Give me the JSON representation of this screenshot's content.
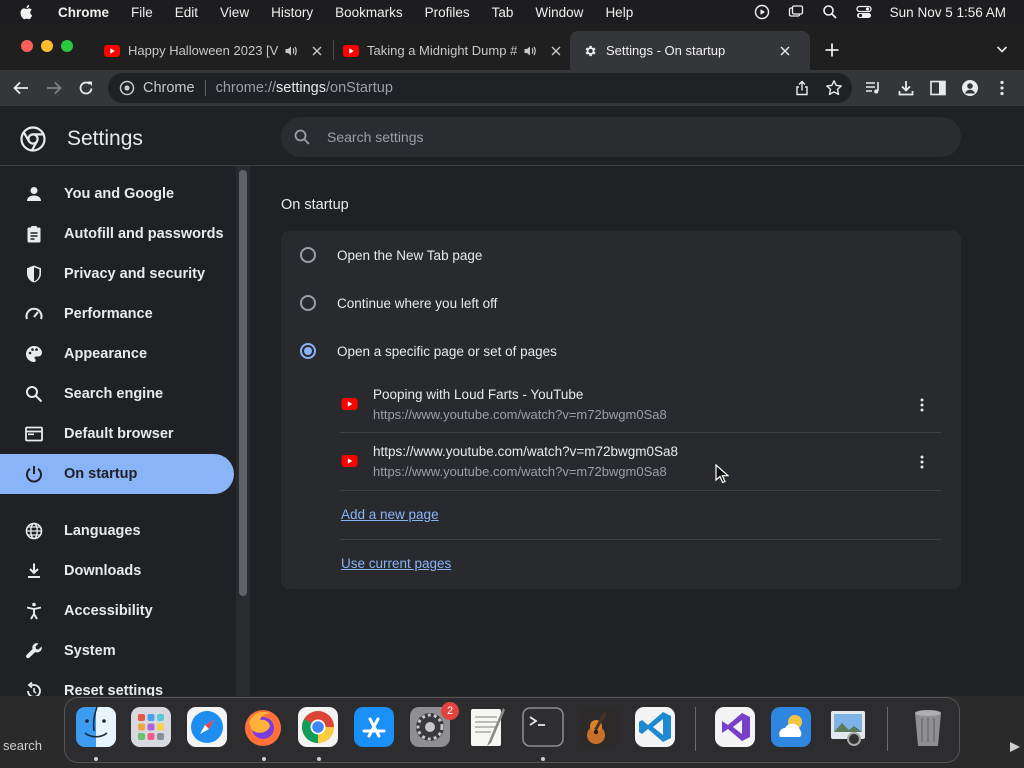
{
  "menubar": {
    "app": "Chrome",
    "items": [
      "File",
      "Edit",
      "View",
      "History",
      "Bookmarks",
      "Profiles",
      "Tab",
      "Window",
      "Help"
    ],
    "datetime": "Sun Nov 5  1:56 AM"
  },
  "tabs": [
    {
      "title": "Happy Halloween 2023 [V",
      "favicon": "youtube-icon",
      "audio": true
    },
    {
      "title": "Taking a Midnight Dump #",
      "favicon": "youtube-icon",
      "audio": true
    },
    {
      "title": "Settings - On startup",
      "favicon": "gear-icon",
      "active": true
    }
  ],
  "omnibox": {
    "host": "Chrome",
    "scheme": "chrome://",
    "path_main": "settings",
    "path_rest": "/onStartup"
  },
  "settings": {
    "title": "Settings",
    "search_placeholder": "Search settings"
  },
  "sidebar": {
    "items": [
      {
        "label": "You and Google",
        "icon": "person-icon"
      },
      {
        "label": "Autofill and passwords",
        "icon": "clipboard-icon"
      },
      {
        "label": "Privacy and security",
        "icon": "shield-icon"
      },
      {
        "label": "Performance",
        "icon": "speedometer-icon"
      },
      {
        "label": "Appearance",
        "icon": "palette-icon"
      },
      {
        "label": "Search engine",
        "icon": "search-icon"
      },
      {
        "label": "Default browser",
        "icon": "browser-icon"
      },
      {
        "label": "On startup",
        "icon": "power-icon",
        "selected": true
      },
      {
        "label": "Languages",
        "icon": "globe-icon"
      },
      {
        "label": "Downloads",
        "icon": "download-icon"
      },
      {
        "label": "Accessibility",
        "icon": "accessibility-icon"
      },
      {
        "label": "System",
        "icon": "wrench-icon"
      },
      {
        "label": "Reset settings",
        "icon": "reset-icon"
      }
    ]
  },
  "startup": {
    "section_title": "On startup",
    "options": [
      {
        "label": "Open the New Tab page",
        "selected": false
      },
      {
        "label": "Continue where you left off",
        "selected": false
      },
      {
        "label": "Open a specific page or set of pages",
        "selected": true
      }
    ],
    "pages": [
      {
        "title": "Pooping with Loud Farts - YouTube",
        "url": "https://www.youtube.com/watch?v=m72bwgm0Sa8"
      },
      {
        "title": "https://www.youtube.com/watch?v=m72bwgm0Sa8",
        "url": "https://www.youtube.com/watch?v=m72bwgm0Sa8"
      }
    ],
    "add_page": "Add a new page",
    "use_current": "Use current pages"
  },
  "dock": {
    "search_label": "search",
    "settings_badge": "2",
    "apps": [
      "finder-icon",
      "launchpad-icon",
      "safari-icon",
      "firefox-icon",
      "chrome-icon",
      "app-store-icon",
      "system-settings-icon",
      "textedit-icon",
      "terminal-icon",
      "garageband-icon",
      "vscode-icon",
      "visual-studio-icon",
      "weather-icon",
      "preview-icon",
      "trash-icon"
    ]
  },
  "colors": {
    "accent": "#8ab4f8",
    "background": "#202124",
    "card": "#292a2d",
    "youtube_red": "#ff0000"
  }
}
